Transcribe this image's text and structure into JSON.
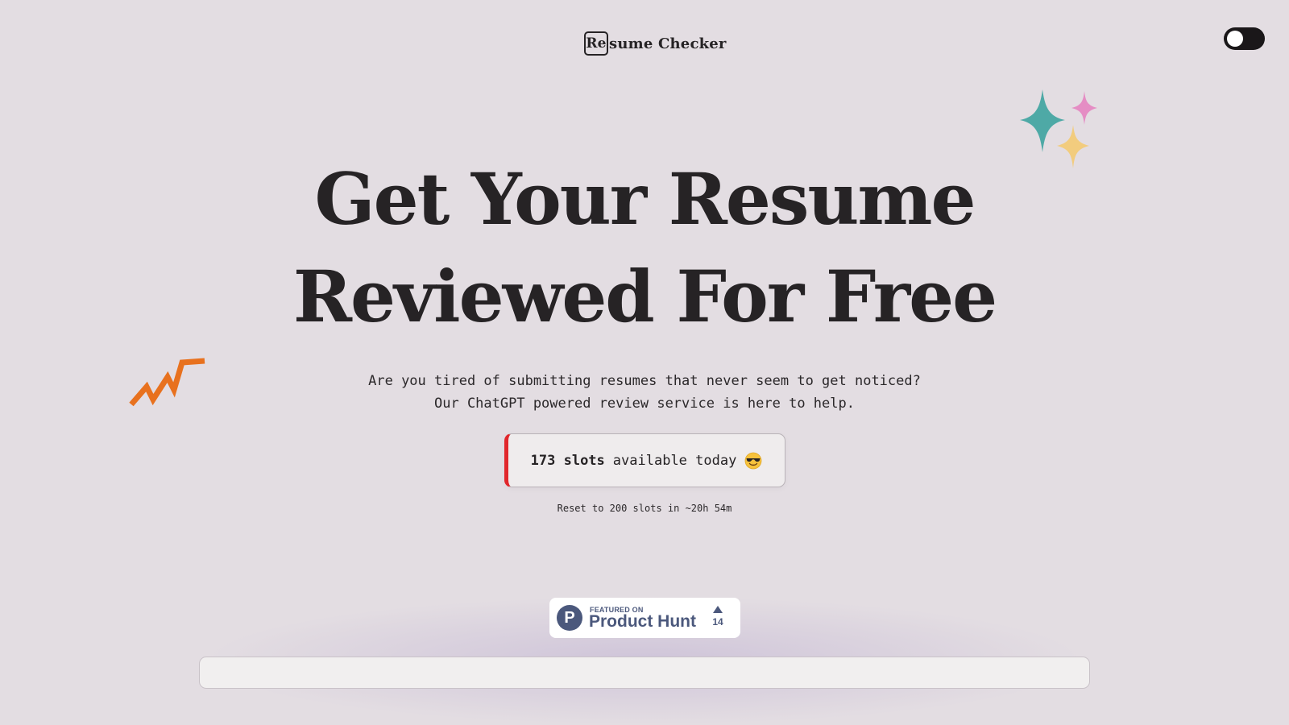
{
  "header": {
    "logo_boxed": "Re",
    "logo_rest": "sume Checker",
    "theme_toggle": "dark-mode-toggle"
  },
  "hero": {
    "title_line1": "Get Your Resume",
    "title_line2": "Reviewed For Free",
    "subtitle_line1": "Are you tired of submitting resumes that never seem to get noticed?",
    "subtitle_line2": "Our ChatGPT powered review service is here to help."
  },
  "slots": {
    "count_label": "173 slots",
    "suffix": "available today",
    "emoji": "smiling-face-with-sunglasses-icon",
    "reset_note": "Reset to 200 slots in ~20h 54m",
    "accent_color": "#e1262b"
  },
  "product_hunt": {
    "featured_label": "FEATURED ON",
    "name": "Product Hunt",
    "logo_letter": "P",
    "upvotes": "14",
    "brand_color": "#4b587c"
  },
  "decorations": {
    "sparkles": "sparkles-icon",
    "sparkle_colors": [
      "#4ea9a6",
      "#e58dc4",
      "#f2cc7e"
    ],
    "zigzag": "zigzag-icon",
    "zigzag_color": "#e8711e"
  },
  "colors": {
    "background": "#e3dde2",
    "text": "#262325"
  }
}
